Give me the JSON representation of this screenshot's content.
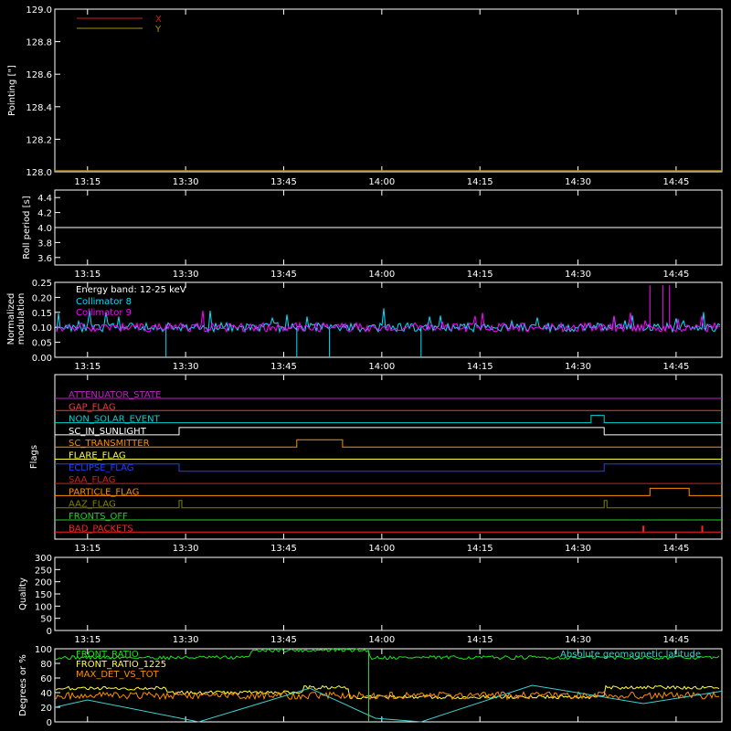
{
  "time_ticks": [
    "13:15",
    "13:30",
    "13:45",
    "14:00",
    "14:15",
    "14:30",
    "14:45"
  ],
  "chart_data": [
    {
      "type": "line",
      "ylabel": "Pointing [\"]",
      "ylim": [
        128.0,
        129.0
      ],
      "y_ticks": [
        "128.0",
        "128.2",
        "128.4",
        "128.6",
        "128.8",
        "129.0"
      ],
      "legend_position": "top-left",
      "series": [
        {
          "name": "X",
          "color": "#d02020",
          "values": []
        },
        {
          "name": "Y",
          "color": "#b08a1a",
          "values": []
        }
      ]
    },
    {
      "type": "line",
      "ylabel": "Roll period [s]",
      "ylim": [
        3.5,
        4.5
      ],
      "y_ticks": [
        "3.6",
        "3.8",
        "4.0",
        "4.2",
        "4.4"
      ],
      "series": [
        {
          "color": "#ffffff",
          "x": [
            "13:10",
            "14:52"
          ],
          "y": [
            4.0,
            4.0
          ]
        }
      ]
    },
    {
      "type": "line",
      "ylabel": "Normalized modulation",
      "ylim": [
        0.0,
        0.25
      ],
      "y_ticks": [
        "0.00",
        "0.05",
        "0.10",
        "0.15",
        "0.20",
        "0.25"
      ],
      "annotation": "Energy band: 12-25 keV",
      "legend_position": "top-left",
      "series": [
        {
          "name": "Collimator 8",
          "color": "#00e0ff",
          "baseline": 0.1,
          "dips_to_zero_at": [
            "13:27",
            "13:47",
            "13:52",
            "14:06"
          ]
        },
        {
          "name": "Collimator 9",
          "color": "#ff00ff",
          "baseline": 0.1,
          "spikes_at": [
            "14:41",
            "14:43",
            "14:44"
          ]
        }
      ]
    },
    {
      "type": "line",
      "ylabel": "Flags",
      "series": [
        {
          "name": "ATTENUATOR_STATE",
          "color": "#c020c0",
          "transitions": []
        },
        {
          "name": "GAP_FLAG",
          "color": "#e04040",
          "transitions": []
        },
        {
          "name": "NON_SOLAR_EVENT",
          "color": "#00d0d0",
          "transitions": [
            "14:32",
            "14:34"
          ]
        },
        {
          "name": "SC_IN_SUNLIGHT",
          "color": "#ffffff",
          "transitions": [
            "13:29",
            "14:34"
          ]
        },
        {
          "name": "SC_TRANSMITTER",
          "color": "#ff8c00",
          "transitions": [
            "13:47",
            "13:54"
          ]
        },
        {
          "name": "FLARE_FLAG",
          "color": "#ffff40",
          "transitions": []
        },
        {
          "name": "ECLIPSE_FLAG",
          "color": "#2040ff",
          "transitions": [
            "13:29",
            "14:34"
          ]
        },
        {
          "name": "SAA_FLAG",
          "color": "#d02020",
          "transitions": []
        },
        {
          "name": "PARTICLE_FLAG",
          "color": "#ff8c00",
          "transitions": [
            "14:41",
            "14:47"
          ]
        },
        {
          "name": "AAZ_FLAG",
          "color": "#808000",
          "transitions": [
            "13:29",
            "14:34"
          ]
        },
        {
          "name": "FRONTS_OFF",
          "color": "#20d020",
          "transitions": []
        },
        {
          "name": "BAD_PACKETS",
          "color": "#ff2020",
          "transitions": [
            "14:40",
            "14:49"
          ]
        }
      ]
    },
    {
      "type": "line",
      "ylabel": "Quality",
      "ylim": [
        0,
        300
      ],
      "y_ticks": [
        "0",
        "50",
        "100",
        "150",
        "200",
        "250",
        "300"
      ],
      "series": []
    },
    {
      "type": "line",
      "ylabel": "Degrees or %",
      "ylim": [
        0,
        100
      ],
      "y_ticks": [
        "0",
        "20",
        "40",
        "60",
        "80",
        "100"
      ],
      "legend_position": "top-left",
      "series": [
        {
          "name": "FRONT_RATIO",
          "color": "#20e020",
          "x": [
            "13:10",
            "13:39",
            "13:40",
            "13:57",
            "13:58",
            "14:52"
          ],
          "y": [
            88,
            88,
            98,
            98,
            88,
            98
          ]
        },
        {
          "name": "FRONT_RATIO_1225",
          "color": "#ffff40",
          "x": [
            "13:10",
            "13:27",
            "13:48",
            "13:55",
            "14:34",
            "14:52"
          ],
          "y": [
            46,
            40,
            47,
            34,
            47,
            47
          ]
        },
        {
          "name": "MAX_DET_VS_TOT",
          "color": "#ff8c00",
          "x": [
            "13:10",
            "14:52"
          ],
          "y": [
            36,
            37
          ]
        },
        {
          "name": "Absolute geomagnetic latitude",
          "color": "#40d0d0",
          "x": [
            "13:10",
            "13:15",
            "13:32",
            "13:49",
            "13:59",
            "14:06",
            "14:23",
            "14:40",
            "14:52"
          ],
          "y": [
            20,
            30,
            0,
            46,
            5,
            0,
            50,
            25,
            42
          ]
        }
      ]
    }
  ]
}
